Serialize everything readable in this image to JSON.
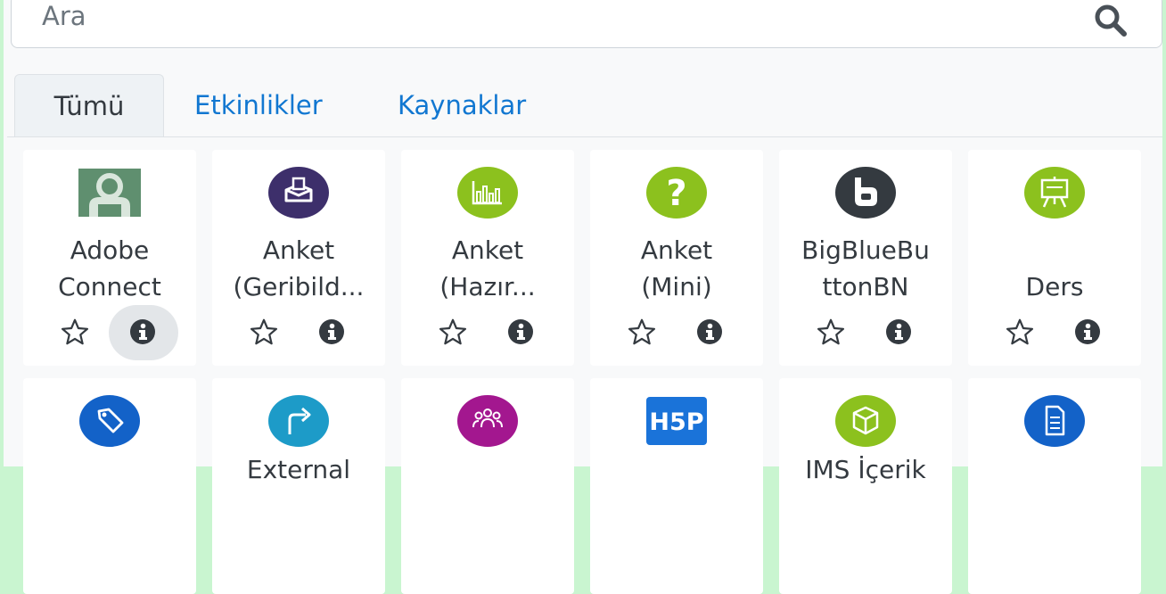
{
  "search": {
    "placeholder": "Ara"
  },
  "tabs": [
    {
      "label": "Tümü"
    },
    {
      "label": "Etkinlikler"
    },
    {
      "label": "Kaynaklar"
    }
  ],
  "row1": [
    {
      "line1": "Adobe",
      "line2": "Connect",
      "icon": "adobe-connect-icon"
    },
    {
      "line1": "Anket",
      "line2": "(Geribild...",
      "icon": "feedback-icon"
    },
    {
      "line1": "Anket",
      "line2": "(Hazır...",
      "icon": "survey-chart-icon"
    },
    {
      "line1": "Anket",
      "line2": "(Mini)",
      "icon": "question-icon"
    },
    {
      "line1": "BigBlueBu",
      "line2": "ttonBN",
      "icon": "bigbluebutton-icon"
    },
    {
      "line1": "",
      "line2": "Ders",
      "icon": "presentation-icon"
    }
  ],
  "row2": [
    {
      "label": "",
      "icon": "tag-icon"
    },
    {
      "label": "External",
      "icon": "external-arrow-icon"
    },
    {
      "label": "",
      "icon": "group-icon"
    },
    {
      "label": "",
      "icon": "h5p-icon"
    },
    {
      "label": "IMS İçerik",
      "icon": "ims-package-icon"
    },
    {
      "label": "",
      "icon": "page-icon"
    }
  ],
  "colors": {
    "link": "#1177d1",
    "purple_dark": "#3d2f6b",
    "green": "#8cc11e",
    "blue": "#1362c8",
    "magenta": "#a3178f"
  }
}
